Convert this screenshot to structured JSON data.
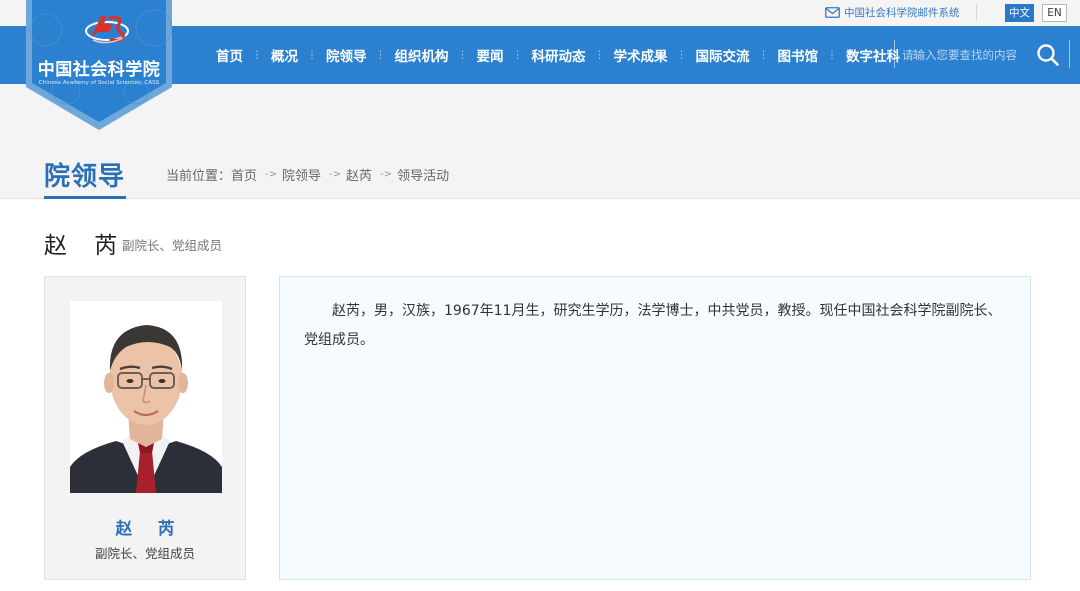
{
  "topbar": {
    "mail_label": "中国社会科学院邮件系统",
    "lang_zh": "中文",
    "lang_en": "EN"
  },
  "logo": {
    "title": "中国社会科学院",
    "subtitle": "Chinese Academy of Social Sciences, CASS",
    "mark_text": "CASS"
  },
  "nav": {
    "items": [
      {
        "label": "首页"
      },
      {
        "label": "概况"
      },
      {
        "label": "院领导"
      },
      {
        "label": "组织机构"
      },
      {
        "label": "要闻"
      },
      {
        "label": "科研动态"
      },
      {
        "label": "学术成果"
      },
      {
        "label": "国际交流"
      },
      {
        "label": "图书馆"
      },
      {
        "label": "数字社科"
      }
    ],
    "separator": "⋮",
    "search_placeholder": "请输入您要查找的内容"
  },
  "section": {
    "title": "院领导"
  },
  "breadcrumb": {
    "prefix": "当前位置：",
    "arrow": "->",
    "items": [
      {
        "label": "首页"
      },
      {
        "label": "院领导"
      },
      {
        "label": "赵芮"
      },
      {
        "label": "领导活动"
      }
    ]
  },
  "person": {
    "name": "赵 芮",
    "title": "副院长、党组成员",
    "bio": "赵芮，男，汉族，1967年11月生，研究生学历，法学博士，中共党员，教授。现任中国社会科学院副院长、党组成员。"
  },
  "colors": {
    "brand_blue": "#2b81d0",
    "heading_blue": "#2b6fb6",
    "logo_red": "#d7332c"
  }
}
